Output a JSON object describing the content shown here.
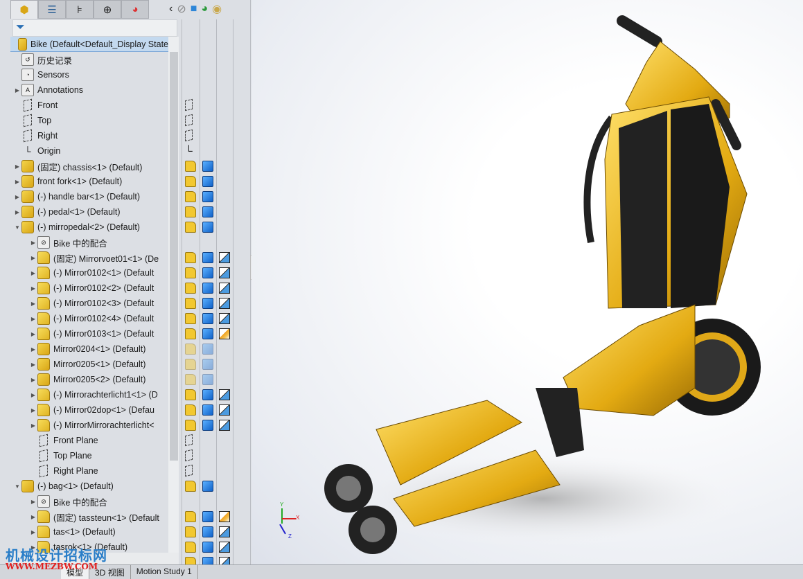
{
  "tabs": [
    {
      "icon": "feature-manager-icon"
    },
    {
      "icon": "property-manager-icon"
    },
    {
      "icon": "configuration-manager-icon"
    },
    {
      "icon": "dimxpert-icon"
    },
    {
      "icon": "display-manager-icon"
    }
  ],
  "toolbar_icons": [
    "collapse-left-icon",
    "hide-show-icon",
    "display-style-icon",
    "appearance-icon",
    "scene-icon"
  ],
  "tree": [
    {
      "label": "Bike  (Default<Default_Display State",
      "level": 0,
      "icon": "asm",
      "selected": true
    },
    {
      "label": "历史记录",
      "level": 1,
      "icon": "history"
    },
    {
      "label": "Sensors",
      "level": 1,
      "icon": "sensor"
    },
    {
      "label": "Annotations",
      "level": 1,
      "icon": "annot",
      "exp": true
    },
    {
      "label": "Front",
      "level": 1,
      "icon": "plane",
      "c1": "plane"
    },
    {
      "label": "Top",
      "level": 1,
      "icon": "plane",
      "c1": "plane"
    },
    {
      "label": "Right",
      "level": 1,
      "icon": "plane",
      "c1": "plane"
    },
    {
      "label": "Origin",
      "level": 1,
      "icon": "origin",
      "c1": "origin"
    },
    {
      "label": "(固定) chassis<1> (Default)",
      "level": 1,
      "icon": "asm",
      "exp": true,
      "c1": "asm",
      "c2": "cube"
    },
    {
      "label": "front fork<1> (Default)",
      "level": 1,
      "icon": "asm",
      "exp": true,
      "c1": "asm",
      "c2": "cube"
    },
    {
      "label": "(-) handle bar<1> (Default)",
      "level": 1,
      "icon": "asm",
      "exp": true,
      "c1": "asm",
      "c2": "cube"
    },
    {
      "label": "(-) pedal<1> (Default)",
      "level": 1,
      "icon": "asm",
      "exp": true,
      "c1": "asm",
      "c2": "cube"
    },
    {
      "label": "(-) mirropedal<2> (Default)",
      "level": 1,
      "icon": "asm",
      "open": true,
      "c1": "asm",
      "c2": "cube"
    },
    {
      "label": "Bike 中的配合",
      "level": 2,
      "icon": "mates",
      "exp": true
    },
    {
      "label": "(固定) Mirrorvoet01<1> (De",
      "level": 2,
      "icon": "part",
      "exp": true,
      "c1": "part",
      "c2": "cube",
      "c3": "appr"
    },
    {
      "label": "(-) Mirror0102<1> (Default",
      "level": 2,
      "icon": "part",
      "exp": true,
      "c1": "part",
      "c2": "cube",
      "c3": "appr"
    },
    {
      "label": "(-) Mirror0102<2> (Default",
      "level": 2,
      "icon": "part",
      "exp": true,
      "c1": "part",
      "c2": "cube",
      "c3": "appr"
    },
    {
      "label": "(-) Mirror0102<3> (Default",
      "level": 2,
      "icon": "part",
      "exp": true,
      "c1": "part",
      "c2": "cube",
      "c3": "appr"
    },
    {
      "label": "(-) Mirror0102<4> (Default",
      "level": 2,
      "icon": "part",
      "exp": true,
      "c1": "part",
      "c2": "cube",
      "c3": "appr"
    },
    {
      "label": "(-) Mirror0103<1> (Default",
      "level": 2,
      "icon": "part",
      "exp": true,
      "c1": "part",
      "c2": "cube",
      "c3": "appr-gold"
    },
    {
      "label": "Mirror0204<1> (Default)",
      "level": 2,
      "icon": "asm",
      "exp": true,
      "c1": "asm-dim",
      "c2": "cube-dim"
    },
    {
      "label": "Mirror0205<1> (Default)",
      "level": 2,
      "icon": "asm",
      "exp": true,
      "c1": "asm-dim",
      "c2": "cube-dim"
    },
    {
      "label": "Mirror0205<2> (Default)",
      "level": 2,
      "icon": "asm",
      "exp": true,
      "c1": "asm-dim",
      "c2": "cube-dim"
    },
    {
      "label": "(-) Mirrorachterlicht1<1> (D",
      "level": 2,
      "icon": "part",
      "exp": true,
      "c1": "part",
      "c2": "cube",
      "c3": "appr"
    },
    {
      "label": "(-) Mirror02dop<1> (Defau",
      "level": 2,
      "icon": "part",
      "exp": true,
      "c1": "part",
      "c2": "cube",
      "c3": "appr"
    },
    {
      "label": "(-) MirrorMirrorachterlicht<",
      "level": 2,
      "icon": "part",
      "exp": true,
      "c1": "part",
      "c2": "cube",
      "c3": "appr"
    },
    {
      "label": "Front Plane",
      "level": 2,
      "icon": "plane",
      "c1": "plane"
    },
    {
      "label": "Top Plane",
      "level": 2,
      "icon": "plane",
      "c1": "plane"
    },
    {
      "label": "Right Plane",
      "level": 2,
      "icon": "plane",
      "c1": "plane"
    },
    {
      "label": "(-) bag<1> (Default)",
      "level": 1,
      "icon": "asm",
      "open": true,
      "c1": "asm",
      "c2": "cube"
    },
    {
      "label": "Bike 中的配合",
      "level": 2,
      "icon": "mates",
      "exp": true
    },
    {
      "label": "(固定) tassteun<1> (Default",
      "level": 2,
      "icon": "part",
      "exp": true,
      "c1": "part",
      "c2": "cube",
      "c3": "appr-gold"
    },
    {
      "label": "tas<1> (Default)",
      "level": 2,
      "icon": "part",
      "exp": true,
      "c1": "part",
      "c2": "cube",
      "c3": "appr"
    },
    {
      "label": "tasrok<1> (Default)",
      "level": 2,
      "icon": "part",
      "exp": true,
      "c1": "part",
      "c2": "cube",
      "c3": "appr"
    }
  ],
  "extra_col_row": {
    "c1": "part",
    "c2": "cube",
    "c3": "appr"
  },
  "bottom_tabs": [
    {
      "label": "模型",
      "active": true
    },
    {
      "label": "3D 视图"
    },
    {
      "label": "Motion Study 1"
    }
  ],
  "triad": {
    "x": "X",
    "y": "Y",
    "z": "Z"
  },
  "watermark": {
    "line1": "机械设计招标网",
    "line2": "WWW.MEZBW.COM"
  },
  "colors": {
    "selection": "#c3d9ef",
    "part_yellow": "#f2c830",
    "model_gold": "#e8b21c"
  }
}
